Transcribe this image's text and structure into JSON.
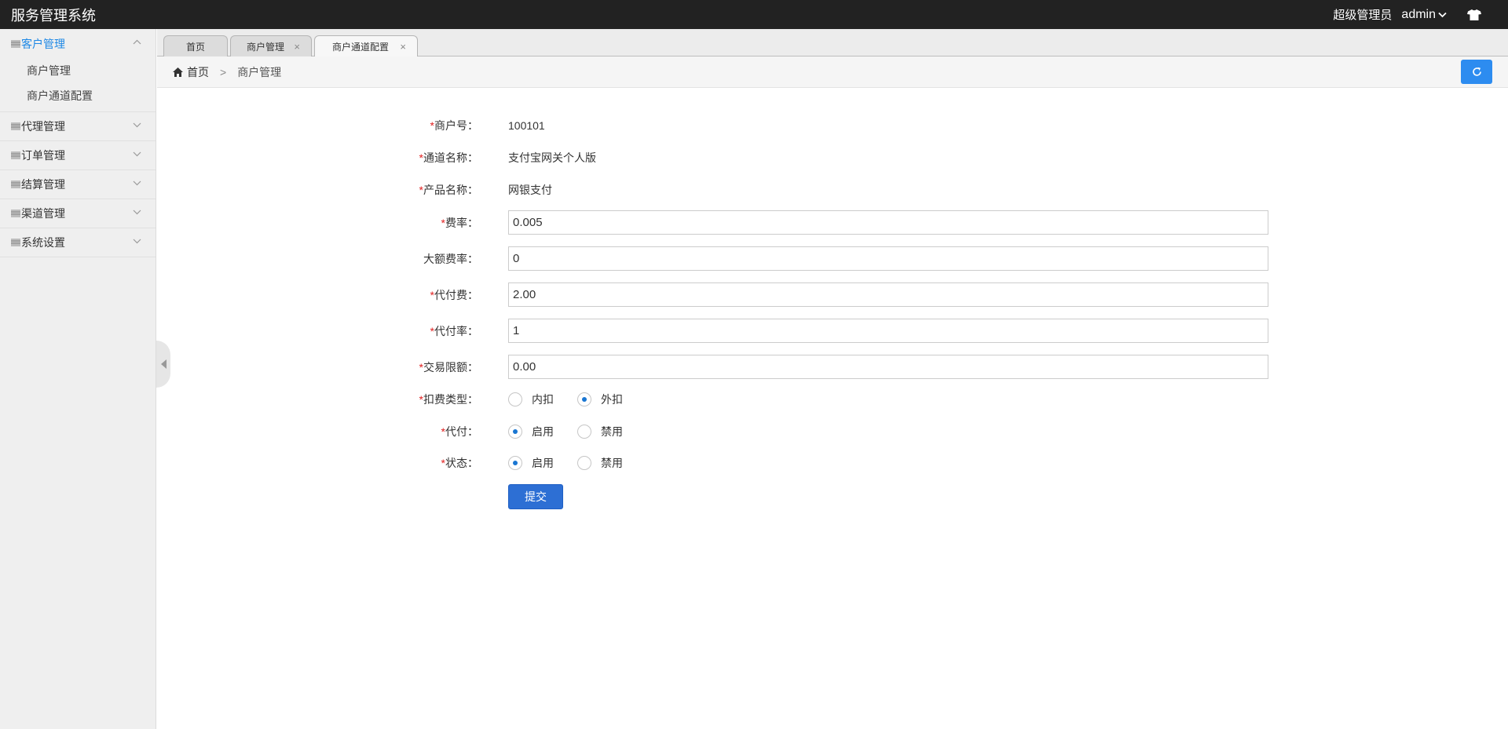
{
  "header": {
    "app_title": "服务管理系统",
    "user_role": "超级管理员",
    "user_name": "admin"
  },
  "sidebar": {
    "groups": [
      {
        "label": "客户管理",
        "expanded": true,
        "items": [
          "商户管理",
          "商户通道配置"
        ]
      },
      {
        "label": "代理管理",
        "expanded": false
      },
      {
        "label": "订单管理",
        "expanded": false
      },
      {
        "label": "结算管理",
        "expanded": false
      },
      {
        "label": "渠道管理",
        "expanded": false
      },
      {
        "label": "系统设置",
        "expanded": false
      }
    ]
  },
  "tabs": [
    {
      "label": "首页",
      "closable": false,
      "active": false
    },
    {
      "label": "商户管理",
      "closable": true,
      "active": false
    },
    {
      "label": "商户通道配置",
      "closable": true,
      "active": true
    }
  ],
  "breadcrumb": {
    "home": "首页",
    "separator": ">",
    "current": "商户管理"
  },
  "form": {
    "merchant_no": {
      "label": "商户号：",
      "value": "100101"
    },
    "channel_name": {
      "label": "通道名称：",
      "value": "支付宝网关个人版"
    },
    "product_name": {
      "label": "产品名称：",
      "value": "网银支付"
    },
    "rate": {
      "label": "费率：",
      "value": "0.005"
    },
    "large_rate": {
      "label": "大额费率：",
      "value": "0"
    },
    "payout_fee": {
      "label": "代付费：",
      "value": "2.00"
    },
    "payout_rate": {
      "label": "代付率：",
      "value": "1"
    },
    "trade_limit": {
      "label": "交易限额：",
      "value": "0.00"
    },
    "deduct_type": {
      "label": "扣费类型：",
      "options": [
        "内扣",
        "外扣"
      ],
      "selected": "外扣"
    },
    "payout": {
      "label": "代付：",
      "options": [
        "启用",
        "禁用"
      ],
      "selected": "启用"
    },
    "status": {
      "label": "状态：",
      "options": [
        "启用",
        "禁用"
      ],
      "selected": "启用"
    },
    "submit_label": "提交"
  },
  "colors": {
    "topbar": "#222222",
    "accent": "#1e88e5",
    "primary_button": "#2d6fd4",
    "required": "#e02020"
  }
}
